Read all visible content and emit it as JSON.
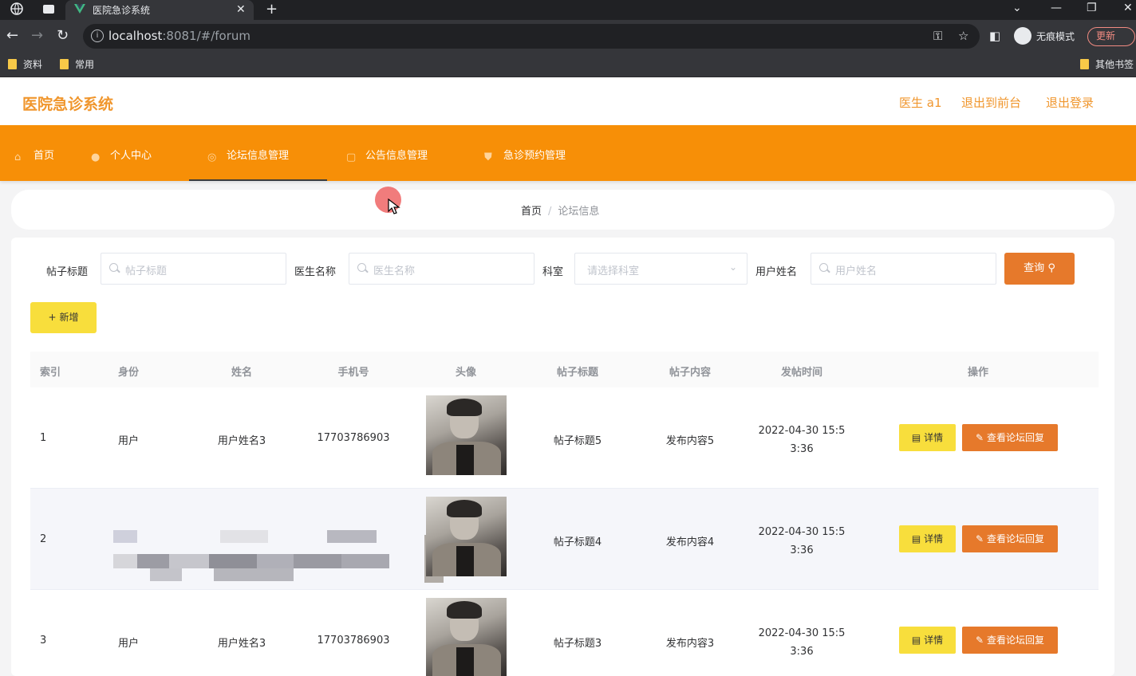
{
  "browser": {
    "tab_title": "医院急诊系统",
    "url_host": "localhost",
    "url_rest": ":8081/#/forum",
    "incognito_label": "无痕模式",
    "update_label": "更新",
    "bookmarks": [
      "资料",
      "常用"
    ],
    "other_bookmarks": "其他书签"
  },
  "app": {
    "title": "医院急诊系统",
    "user": "医生 a1",
    "back_to_front": "退出到前台",
    "logout": "退出登录"
  },
  "menu": [
    "首页",
    "个人中心",
    "论坛信息管理",
    "公告信息管理",
    "急诊预约管理"
  ],
  "breadcrumb": {
    "home": "首页",
    "separator": "/",
    "current": "论坛信息"
  },
  "search": {
    "post_title_label": "帖子标题",
    "post_title_placeholder": "帖子标题",
    "doctor_label": "医生名称",
    "doctor_placeholder": "医生名称",
    "dept_label": "科室",
    "dept_placeholder": "请选择科室",
    "user_label": "用户姓名",
    "user_placeholder": "用户姓名",
    "query_button": "查询"
  },
  "add_button": "新增",
  "table": {
    "headers": [
      "索引",
      "身份",
      "姓名",
      "手机号",
      "头像",
      "帖子标题",
      "帖子内容",
      "发帖时间",
      "操作"
    ],
    "rows": [
      {
        "index": "1",
        "role": "用户",
        "name": "用户姓名3",
        "phone": "17703786903",
        "title": "帖子标题5",
        "content": "发布内容5",
        "time1": "2022-04-30 15:5",
        "time2": "3:36"
      },
      {
        "index": "2",
        "role": "",
        "name": "",
        "phone": "",
        "title": "帖子标题4",
        "content": "发布内容4",
        "time1": "2022-04-30 15:5",
        "time2": "3:36"
      },
      {
        "index": "3",
        "role": "用户",
        "name": "用户姓名3",
        "phone": "17703786903",
        "title": "帖子标题3",
        "content": "发布内容3",
        "time1": "2022-04-30 15:5",
        "time2": "3:36"
      }
    ],
    "detail_button": "详情",
    "reply_button": "查看论坛回复"
  },
  "colors": {
    "accent": "#f78f07",
    "brand_text": "#f0962d",
    "yellow_button": "#f8de3c",
    "orange_button": "#e6792b"
  }
}
